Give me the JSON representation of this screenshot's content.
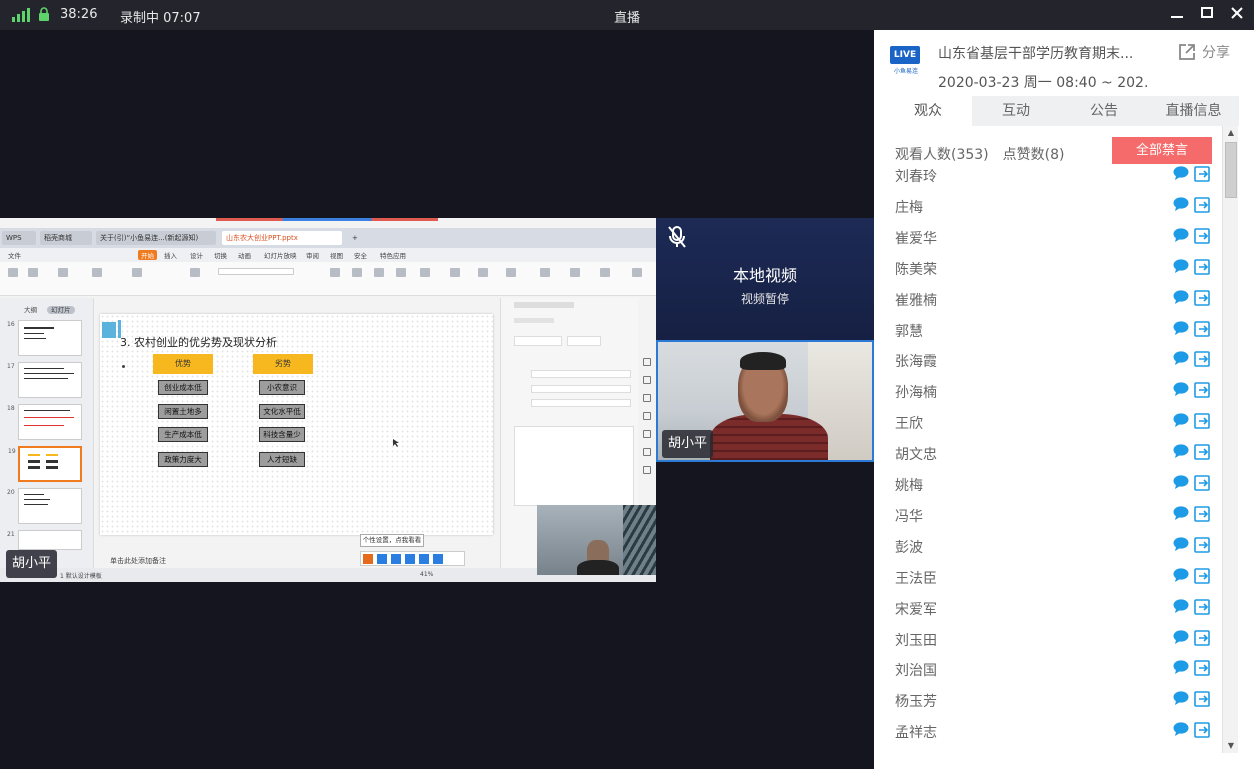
{
  "topbar": {
    "duration": "38:26",
    "recording": "录制中 07:07",
    "title": "直播"
  },
  "screen_share": {
    "browser_tabs": [
      "WPS",
      "稻壳商城",
      "关于(引)“小鱼易连...(新起源知)",
      "山东农大创业PPT.pptx"
    ],
    "menu_items": [
      "文件",
      "开始",
      "插入",
      "设计",
      "切换",
      "动画",
      "幻灯片放映",
      "审阅",
      "视图",
      "安全",
      "特色应用"
    ],
    "thumb_tabs": [
      "大纲",
      "幻灯片"
    ],
    "slide_numbers": [
      "16",
      "17",
      "18",
      "19",
      "20",
      "21"
    ],
    "slide_title": "3.  农村创业的优劣势及现状分析",
    "advantages_header": "优势",
    "disadvantages_header": "劣势",
    "advantages": [
      "创业成本低",
      "闲置土地多",
      "生产成本低",
      "政策力度大"
    ],
    "disadvantages": [
      "小农意识",
      "文化水平低",
      "科技含量少",
      "人才短缺"
    ],
    "tooltip": "个性设置，点我看看",
    "notes_placeholder": "单击此处添加备注",
    "status_left": "1  默认设计模板",
    "zoom": "41%",
    "presenter_name": "胡小平"
  },
  "local_video": {
    "title": "本地视频",
    "status": "视频暂停"
  },
  "camera": {
    "name": "胡小平"
  },
  "panel": {
    "live_badge": "LIVE",
    "live_sub": "小鱼易连",
    "title": "山东省基层干部学历教育期末...",
    "date": "2020-03-23 周一 08:40 ~ 202...",
    "share_label": "分享",
    "tabs": [
      "观众",
      "互动",
      "公告",
      "直播信息"
    ],
    "viewers_label": "观看人数(353)",
    "likes_label": "点赞数(8)",
    "mute_all_label": "全部禁言",
    "viewers": [
      "刘春玲",
      "庄梅",
      "崔爱华",
      "陈美荣",
      "崔雅楠",
      "郭慧",
      "张海霞",
      "孙海楠",
      "王欣",
      "胡文忠",
      "姚梅",
      "冯华",
      "彭波",
      "王法臣",
      "宋爱军",
      "刘玉田",
      "刘治国",
      "杨玉芳",
      "孟祥志"
    ]
  },
  "colors": {
    "accent": "#1a64c8",
    "mute_button": "#f56a6a",
    "icon_blue": "#1e9be6",
    "signal": "#5fd36b"
  }
}
